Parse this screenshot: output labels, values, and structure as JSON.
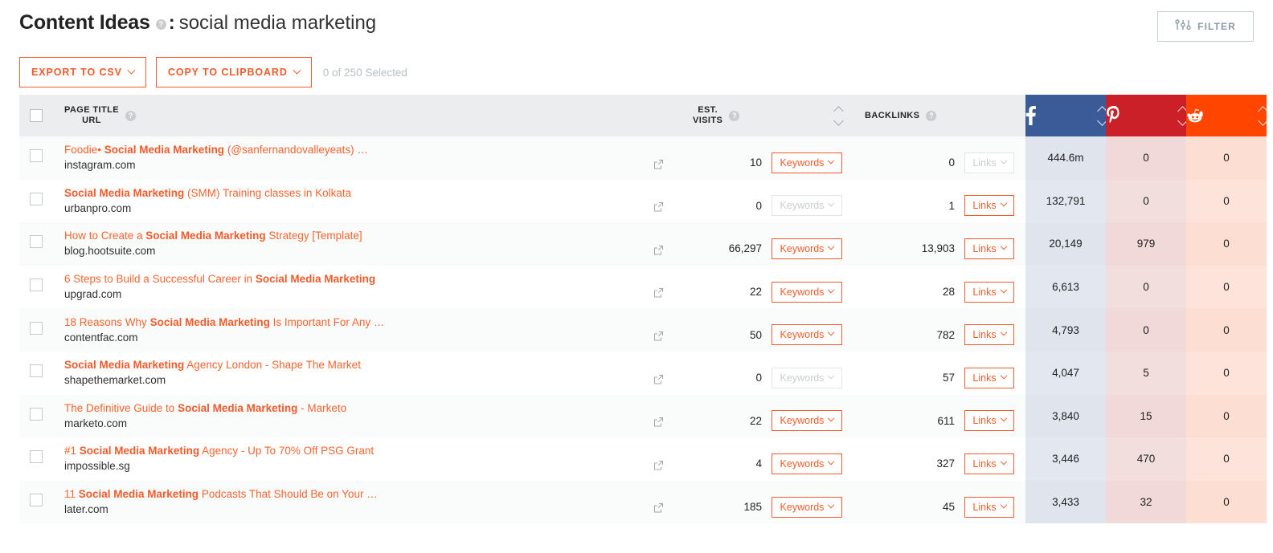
{
  "header": {
    "title": "Content Ideas",
    "help_icon": "question-mark-icon",
    "separator": ":",
    "query": "social media marketing",
    "filter_label": "FILTER",
    "filter_icon": "sliders-icon"
  },
  "toolbar": {
    "export_label": "EXPORT TO CSV",
    "copy_label": "COPY TO CLIPBOARD",
    "selected_text": "0 of 250 Selected"
  },
  "table": {
    "columns": {
      "select_all": "",
      "page_title": "PAGE TITLE\nURL",
      "est_visits": "EST.\nVISITS",
      "backlinks": "BACKLINKS",
      "facebook": "facebook-icon",
      "pinterest": "pinterest-icon",
      "reddit": "reddit-icon"
    },
    "keywords_button": "Keywords",
    "links_button": "Links",
    "colors": {
      "accent": "#ef5b2b",
      "facebook": "#3a5a98",
      "pinterest": "#cb2027",
      "reddit": "#ff4500",
      "header_bg": "#ebedee"
    },
    "rows": [
      {
        "title_parts": [
          {
            "t": "Foodie• ",
            "b": false
          },
          {
            "t": "Social Media Marketing",
            "b": true
          },
          {
            "t": " (@sanfernandovalleyeats) …",
            "b": false
          }
        ],
        "url": "instagram.com",
        "est_visits": "10",
        "keywords_enabled": true,
        "backlinks": "0",
        "links_enabled": false,
        "facebook": "444.6m",
        "pinterest": "0",
        "reddit": "0"
      },
      {
        "title_parts": [
          {
            "t": "Social Media Marketing",
            "b": true
          },
          {
            "t": " (SMM) Training classes in Kolkata",
            "b": false
          }
        ],
        "url": "urbanpro.com",
        "est_visits": "0",
        "keywords_enabled": false,
        "backlinks": "1",
        "links_enabled": true,
        "facebook": "132,791",
        "pinterest": "0",
        "reddit": "0"
      },
      {
        "title_parts": [
          {
            "t": "How to Create a ",
            "b": false
          },
          {
            "t": "Social Media Marketing",
            "b": true
          },
          {
            "t": " Strategy [Template]",
            "b": false
          }
        ],
        "url": "blog.hootsuite.com",
        "est_visits": "66,297",
        "keywords_enabled": true,
        "backlinks": "13,903",
        "links_enabled": true,
        "facebook": "20,149",
        "pinterest": "979",
        "reddit": "0"
      },
      {
        "title_parts": [
          {
            "t": "6 Steps to Build a Successful Career in ",
            "b": false
          },
          {
            "t": "Social Media Marketing",
            "b": true
          }
        ],
        "url": "upgrad.com",
        "est_visits": "22",
        "keywords_enabled": true,
        "backlinks": "28",
        "links_enabled": true,
        "facebook": "6,613",
        "pinterest": "0",
        "reddit": "0"
      },
      {
        "title_parts": [
          {
            "t": "18 Reasons Why ",
            "b": false
          },
          {
            "t": "Social Media Marketing",
            "b": true
          },
          {
            "t": " Is Important For Any …",
            "b": false
          }
        ],
        "url": "contentfac.com",
        "est_visits": "50",
        "keywords_enabled": true,
        "backlinks": "782",
        "links_enabled": true,
        "facebook": "4,793",
        "pinterest": "0",
        "reddit": "0"
      },
      {
        "title_parts": [
          {
            "t": "Social Media Marketing",
            "b": true
          },
          {
            "t": " Agency London - Shape The Market",
            "b": false
          }
        ],
        "url": "shapethemarket.com",
        "est_visits": "0",
        "keywords_enabled": false,
        "backlinks": "57",
        "links_enabled": true,
        "facebook": "4,047",
        "pinterest": "5",
        "reddit": "0"
      },
      {
        "title_parts": [
          {
            "t": "The Definitive Guide to ",
            "b": false
          },
          {
            "t": "Social Media Marketing",
            "b": true
          },
          {
            "t": " - Marketo",
            "b": false
          }
        ],
        "url": "marketo.com",
        "est_visits": "22",
        "keywords_enabled": true,
        "backlinks": "611",
        "links_enabled": true,
        "facebook": "3,840",
        "pinterest": "15",
        "reddit": "0"
      },
      {
        "title_parts": [
          {
            "t": "#1 ",
            "b": false
          },
          {
            "t": "Social Media Marketing",
            "b": true
          },
          {
            "t": " Agency - Up To 70% Off PSG Grant",
            "b": false
          }
        ],
        "url": "impossible.sg",
        "est_visits": "4",
        "keywords_enabled": true,
        "backlinks": "327",
        "links_enabled": true,
        "facebook": "3,446",
        "pinterest": "470",
        "reddit": "0"
      },
      {
        "title_parts": [
          {
            "t": "11 ",
            "b": false
          },
          {
            "t": "Social Media Marketing",
            "b": true
          },
          {
            "t": " Podcasts That Should Be on Your …",
            "b": false
          }
        ],
        "url": "later.com",
        "est_visits": "185",
        "keywords_enabled": true,
        "backlinks": "45",
        "links_enabled": true,
        "facebook": "3,433",
        "pinterest": "32",
        "reddit": "0"
      }
    ]
  }
}
